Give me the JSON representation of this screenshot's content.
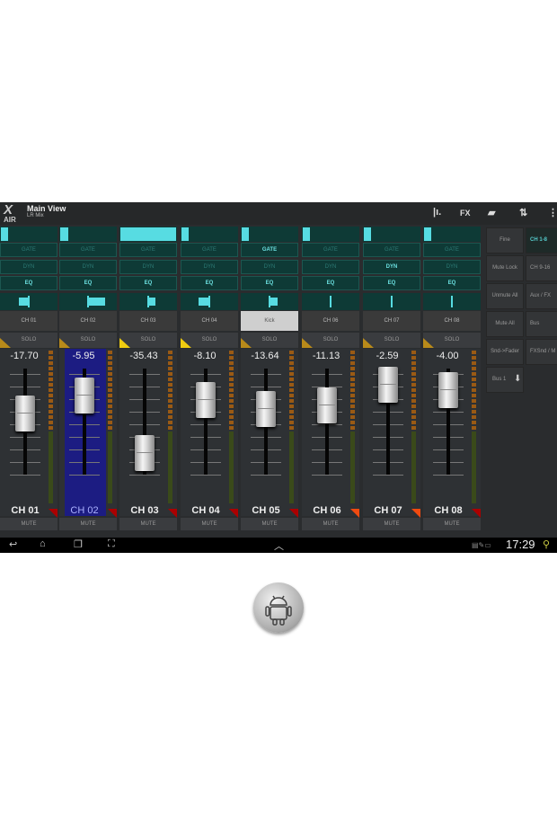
{
  "header": {
    "title": "Main View",
    "subtitle": "LR Mix",
    "logo": "X AIR",
    "icons": [
      "meters-icon",
      "FX",
      "folder-icon",
      "sort-icon",
      "overflow-menu-icon"
    ],
    "fx_label": "FX"
  },
  "buttons": {
    "gate": "GATE",
    "dyn": "DYN",
    "eq": "EQ",
    "solo": "SOLO",
    "mute": "MUTE"
  },
  "channels": [
    {
      "name": "CH 01",
      "label": "CH 01",
      "value": "-17.70",
      "fader": 0.58,
      "trim": 0.1,
      "pan": -0.35,
      "gate": false,
      "dyn": false,
      "eq": true,
      "solo_tri": "dim",
      "mute_tri": "red",
      "selected": false
    },
    {
      "name": "CH 02",
      "label": "CH 02",
      "value": "-5.95",
      "fader": 0.75,
      "trim": 0.17,
      "pan": 0.6,
      "gate": false,
      "dyn": false,
      "eq": true,
      "solo_tri": "dim",
      "mute_tri": "red",
      "selected": true
    },
    {
      "name": "CH 03",
      "label": "CH 03",
      "value": "-35.43",
      "fader": 0.2,
      "trim": 1.0,
      "pan": 0.25,
      "gate": false,
      "dyn": false,
      "eq": true,
      "solo_tri": "yellow",
      "mute_tri": "red",
      "selected": false
    },
    {
      "name": "CH 04",
      "label": "CH 04",
      "value": "-8.10",
      "fader": 0.7,
      "trim": 0.15,
      "pan": -0.4,
      "gate": false,
      "dyn": false,
      "eq": true,
      "solo_tri": "yellow",
      "mute_tri": "red",
      "selected": false
    },
    {
      "name": "Kick",
      "label": "CH 05",
      "value": "-13.64",
      "fader": 0.62,
      "trim": 0.15,
      "pan": 0.3,
      "gate": true,
      "dyn": false,
      "eq": true,
      "solo_tri": "dim",
      "mute_tri": "red",
      "selected": false,
      "name_highlight": true
    },
    {
      "name": "CH 06",
      "label": "CH 06",
      "value": "-11.13",
      "fader": 0.65,
      "trim": 0.15,
      "pan": 0,
      "gate": false,
      "dyn": false,
      "eq": true,
      "solo_tri": "dim",
      "mute_tri": "orange",
      "selected": false
    },
    {
      "name": "CH 07",
      "label": "CH 07",
      "value": "-2.59",
      "fader": 0.85,
      "trim": 0.15,
      "pan": 0,
      "gate": false,
      "dyn": true,
      "eq": true,
      "solo_tri": "dim",
      "mute_tri": "orange",
      "selected": false
    },
    {
      "name": "CH 08",
      "label": "CH 08",
      "value": "-4.00",
      "fader": 0.8,
      "trim": 0.15,
      "pan": 0,
      "gate": false,
      "dyn": false,
      "eq": true,
      "solo_tri": "dim",
      "mute_tri": "red",
      "selected": false
    }
  ],
  "right_panel": {
    "left": [
      "Fine",
      "Mute Lock",
      "Unmute All",
      "Mute All",
      "Snd->Fader",
      "Bus 1"
    ],
    "right": [
      "CH 1-8",
      "CH 9-16",
      "Aux / FX",
      "Bus",
      "FXSnd / M"
    ],
    "active": "CH 1-8"
  },
  "navbar": {
    "time": "17:29",
    "icons": [
      "back-icon",
      "home-icon",
      "recent-apps-icon",
      "screenshot-icon",
      "up-chevron-icon"
    ]
  },
  "colors": {
    "accent": "#57dce2",
    "selected_strip": "#1c1c82",
    "meter": "#9a5a14"
  }
}
